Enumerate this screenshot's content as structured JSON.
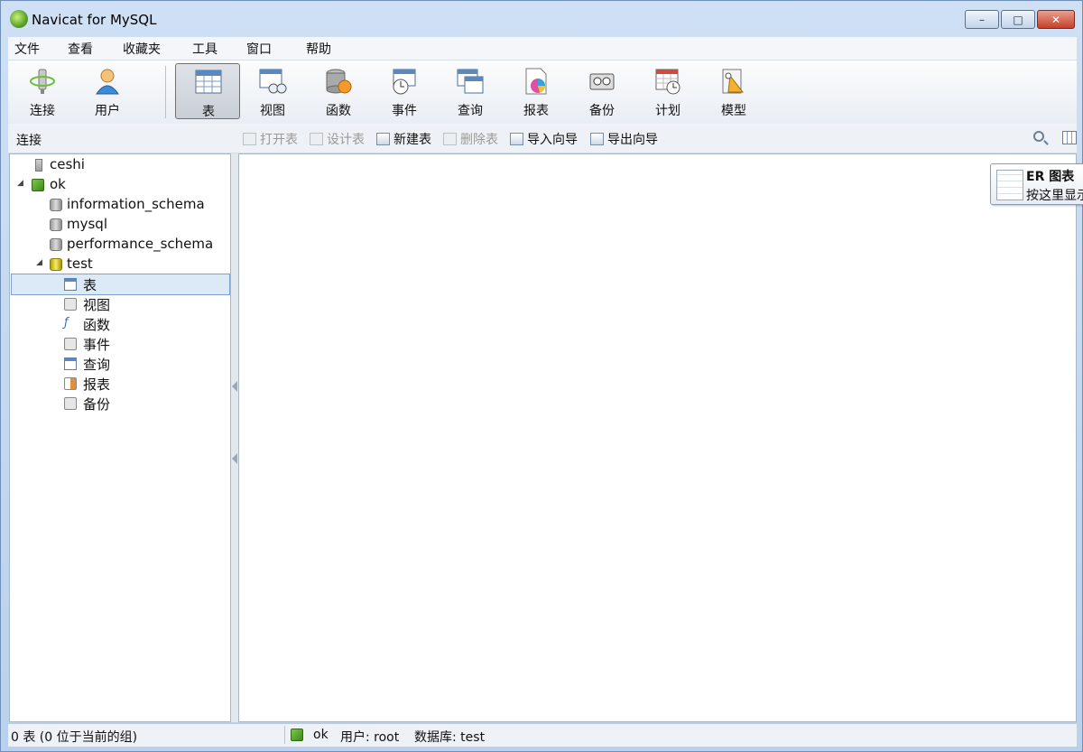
{
  "window": {
    "title": "Navicat for MySQL",
    "minimize": "–",
    "maximize": "□",
    "close": "✕"
  },
  "menu": [
    "文件",
    "查看",
    "收藏夹",
    "工具",
    "窗口",
    "帮助"
  ],
  "toolbar": {
    "connect": "连接",
    "user": "用户",
    "table": "表",
    "view": "视图",
    "function": "函数",
    "event": "事件",
    "query": "查询",
    "report": "报表",
    "backup": "备份",
    "schedule": "计划",
    "model": "模型"
  },
  "subtoolbar": {
    "connections_label": "连接",
    "open_table": "打开表",
    "design_table": "设计表",
    "new_table": "新建表",
    "delete_table": "删除表",
    "import_wizard": "导入向导",
    "export_wizard": "导出向导"
  },
  "tree": {
    "ceshi": "ceshi",
    "ok": "ok",
    "information_schema": "information_schema",
    "mysql": "mysql",
    "performance_schema": "performance_schema",
    "test": "test",
    "tables": "表",
    "views": "视图",
    "functions": "函数",
    "events": "事件",
    "queries": "查询",
    "reports": "报表",
    "backups": "备份"
  },
  "tooltip": {
    "title": "ER 图表",
    "desc": "按这里显示"
  },
  "status": {
    "left": "0 表 (0 位于当前的组)",
    "connection": "ok",
    "user": "用户: root",
    "database": "数据库: test"
  }
}
